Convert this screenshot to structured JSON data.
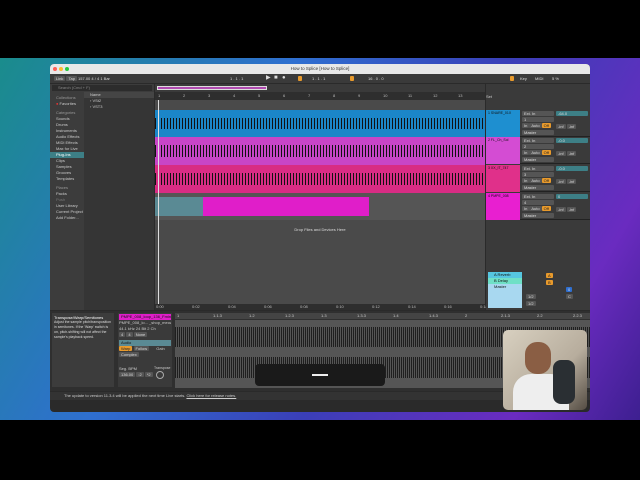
{
  "window": {
    "title": "How to Splice  [How to Splice]"
  },
  "control_bar": {
    "link": "Link",
    "tap": "Tap",
    "tempo": "157.00",
    "time_sig": "4 / 4",
    "quant": "1 Bar",
    "position": "1 . 1 . 1",
    "loop_start": "1 . 1 . 1",
    "loop_len": "16 . 0 . 0",
    "key": "Key",
    "midi": "MIDI",
    "cpu": "5 %"
  },
  "browser": {
    "search_placeholder": "Search (Cmd + F)",
    "collections_label": "Collections",
    "favorites": "Favorites",
    "categories_label": "Categories",
    "categories": [
      "Sounds",
      "Drums",
      "Instruments",
      "Audio Effects",
      "MIDI Effects",
      "Max for Live",
      "Plug-Ins",
      "Clips",
      "Samples",
      "Grooves",
      "Templates"
    ],
    "selected_category": "Plug-Ins",
    "places_label": "Places",
    "places": [
      "Packs",
      "Push",
      "User Library",
      "Current Project",
      "Add Folder..."
    ],
    "name_header": "Name",
    "items": [
      "VSt2",
      "VST3"
    ]
  },
  "ruler": {
    "bars": [
      "1",
      "2",
      "3",
      "4",
      "5",
      "6",
      "7",
      "8",
      "9",
      "10",
      "11",
      "12",
      "13"
    ],
    "set_label": "Set"
  },
  "tracks": [
    {
      "name": "1 SNARE_01X",
      "color": "#1e8fd0",
      "clip_color": "#1b86c8",
      "input": "Ext. In",
      "channel": "1",
      "monitor": [
        "In",
        "Auto",
        "Off"
      ],
      "output": "Master",
      "volume": "-64.0",
      "sends": [
        "-inf",
        "-inf"
      ]
    },
    {
      "name": "2 FL_Ch_Sol",
      "color": "#d44cd3",
      "clip_color": "#c845c7",
      "input": "Ext. In",
      "channel": "2",
      "monitor": [
        "In",
        "Auto",
        "Off"
      ],
      "output": "Master",
      "volume": "-0.0",
      "sends": [
        "-inf",
        "-inf"
      ]
    },
    {
      "name": "3 XX_IT_747",
      "color": "#e0308a",
      "clip_color": "#d82c84",
      "input": "Ext. In",
      "channel": "3",
      "monitor": [
        "In",
        "Auto",
        "Off"
      ],
      "output": "Master",
      "volume": "-0.0",
      "sends": [
        "-inf",
        "-inf"
      ]
    },
    {
      "name": "4 PMPE_008",
      "color": "#e81fd0",
      "clip_color": "#e01ec9",
      "input": "Ext. In",
      "channel": "4",
      "monitor": [
        "In",
        "Auto",
        "Off"
      ],
      "output": "Master",
      "volume": "0",
      "sends": [
        "-inf",
        "-inf"
      ]
    }
  ],
  "drop_hint": "Drop Files and Devices Here",
  "returns": [
    {
      "name": "A Reverb",
      "color": "#56c6e0"
    },
    {
      "name": "B Delay",
      "color": "#6fe0c6"
    },
    {
      "name": "Master",
      "color": "#a8d8f0"
    }
  ],
  "return_controls": {
    "send_a": "A",
    "send_b": "B",
    "master_vol": "0",
    "master_c": "C",
    "sends": [
      "1/2",
      "1/2"
    ]
  },
  "timeline": [
    "0:00",
    "0:02",
    "0:04",
    "0:06",
    "0:08",
    "0:10",
    "0:12",
    "0:14",
    "0:16",
    "0:18"
  ],
  "info_view": {
    "title": "Transpose/Warp/Semitones",
    "body": "Adjust the sample pitch/transposition in semitones. If the 'Warp' switch is on, pitch-shifting will not affect the sample's playback speed."
  },
  "clip": {
    "name": "PMPE_008_loop_136_Fmin",
    "file": "PMPE_008_lo... _shop_meowse",
    "sample_rate": "44.1 kHz",
    "bits": "24 Bit",
    "channels": "2 Ch",
    "sig": [
      "4",
      "4"
    ],
    "groove": "None",
    "warp": "Warp",
    "follow": "Follow",
    "mode": "Complex",
    "bpm_label": "Seg. BPM",
    "bpm": "136.00",
    "half": ":2",
    "double": "*2",
    "gain_label": "Gain",
    "transpose_label": "Transpose",
    "detail_ruler": [
      "1",
      "1.1.3",
      "1.2",
      "1.2.3",
      "1.3",
      "1.3.3",
      "1.4",
      "1.4.3",
      "2",
      "2.1.3",
      "2.2",
      "2.2.3"
    ]
  },
  "status_bar": {
    "text": "The update to version 11.3.4 will be applied the next time Live starts.",
    "link": "Click here for release notes."
  }
}
